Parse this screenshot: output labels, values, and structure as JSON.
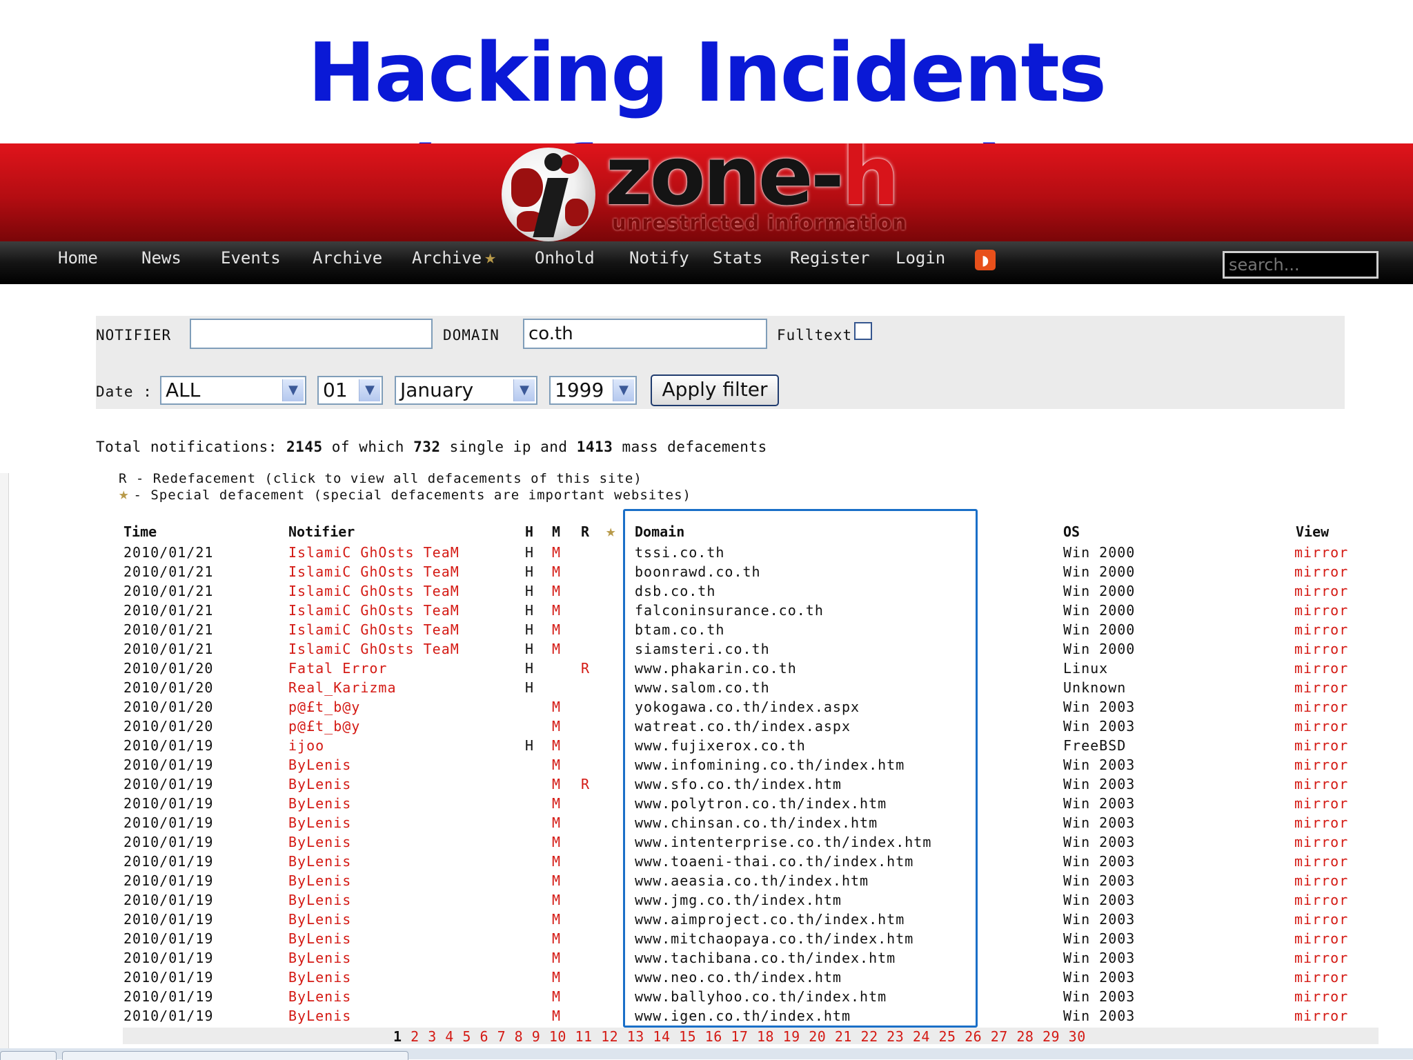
{
  "slide": {
    "title": "Hacking Incidents (Defacement)"
  },
  "logo": {
    "word_main": "zone-",
    "word_accent": "h",
    "tagline": "unrestricted information"
  },
  "nav": {
    "items": [
      "Home",
      "News",
      "Events",
      "Archive",
      "Archive",
      "Onhold",
      "Notify",
      "Stats",
      "Register",
      "Login"
    ],
    "archive_star_icon": "star-icon",
    "rss_icon": "rss-icon",
    "search_placeholder": "search..."
  },
  "filter": {
    "notifier_label": "NOTIFIER",
    "notifier_value": "",
    "domain_label": "DOMAIN",
    "domain_value": "co.th",
    "fulltext_label": "Fulltext",
    "date_label": "Date :",
    "selects": [
      "ALL",
      "01",
      "January",
      "1999"
    ],
    "apply_label": "Apply filter"
  },
  "totals": {
    "prefix": "Total notifications:",
    "total": "2145",
    "mid1": "of which",
    "single": "732",
    "mid2": "single ip and",
    "mass": "1413",
    "suffix": "mass defacements"
  },
  "legend": {
    "r": "R - Redefacement (click to view all defacements of this site)",
    "star": "- Special defacement (special defacements are important websites)"
  },
  "table": {
    "headers": {
      "time": "Time",
      "notifier": "Notifier",
      "h": "H",
      "m": "M",
      "r": "R",
      "domain": "Domain",
      "os": "OS",
      "view": "View"
    },
    "rows": [
      {
        "time": "2010/01/21",
        "notifier": "IslamiC GhOsts TeaM",
        "h": "H",
        "m": "M",
        "r": "",
        "domain": "tssi.co.th",
        "os": "Win 2000",
        "view": "mirror"
      },
      {
        "time": "2010/01/21",
        "notifier": "IslamiC GhOsts TeaM",
        "h": "H",
        "m": "M",
        "r": "",
        "domain": "boonrawd.co.th",
        "os": "Win 2000",
        "view": "mirror"
      },
      {
        "time": "2010/01/21",
        "notifier": "IslamiC GhOsts TeaM",
        "h": "H",
        "m": "M",
        "r": "",
        "domain": "dsb.co.th",
        "os": "Win 2000",
        "view": "mirror"
      },
      {
        "time": "2010/01/21",
        "notifier": "IslamiC GhOsts TeaM",
        "h": "H",
        "m": "M",
        "r": "",
        "domain": "falconinsurance.co.th",
        "os": "Win 2000",
        "view": "mirror"
      },
      {
        "time": "2010/01/21",
        "notifier": "IslamiC GhOsts TeaM",
        "h": "H",
        "m": "M",
        "r": "",
        "domain": "btam.co.th",
        "os": "Win 2000",
        "view": "mirror"
      },
      {
        "time": "2010/01/21",
        "notifier": "IslamiC GhOsts TeaM",
        "h": "H",
        "m": "M",
        "r": "",
        "domain": "siamsteri.co.th",
        "os": "Win 2000",
        "view": "mirror"
      },
      {
        "time": "2010/01/20",
        "notifier": "Fatal Error",
        "h": "H",
        "m": "",
        "r": "R",
        "domain": "www.phakarin.co.th",
        "os": "Linux",
        "view": "mirror"
      },
      {
        "time": "2010/01/20",
        "notifier": "Real_Karizma",
        "h": "H",
        "m": "",
        "r": "",
        "domain": "www.salom.co.th",
        "os": "Unknown",
        "view": "mirror"
      },
      {
        "time": "2010/01/20",
        "notifier": "p@£t_b@y",
        "h": "",
        "m": "M",
        "r": "",
        "domain": "yokogawa.co.th/index.aspx",
        "os": "Win 2003",
        "view": "mirror"
      },
      {
        "time": "2010/01/20",
        "notifier": "p@£t_b@y",
        "h": "",
        "m": "M",
        "r": "",
        "domain": "watreat.co.th/index.aspx",
        "os": "Win 2003",
        "view": "mirror"
      },
      {
        "time": "2010/01/19",
        "notifier": "ijoo",
        "h": "H",
        "m": "M",
        "r": "",
        "domain": "www.fujixerox.co.th",
        "os": "FreeBSD",
        "view": "mirror"
      },
      {
        "time": "2010/01/19",
        "notifier": "ByLenis",
        "h": "",
        "m": "M",
        "r": "",
        "domain": "www.infomining.co.th/index.htm",
        "os": "Win 2003",
        "view": "mirror"
      },
      {
        "time": "2010/01/19",
        "notifier": "ByLenis",
        "h": "",
        "m": "M",
        "r": "R",
        "domain": "www.sfo.co.th/index.htm",
        "os": "Win 2003",
        "view": "mirror"
      },
      {
        "time": "2010/01/19",
        "notifier": "ByLenis",
        "h": "",
        "m": "M",
        "r": "",
        "domain": "www.polytron.co.th/index.htm",
        "os": "Win 2003",
        "view": "mirror"
      },
      {
        "time": "2010/01/19",
        "notifier": "ByLenis",
        "h": "",
        "m": "M",
        "r": "",
        "domain": "www.chinsan.co.th/index.htm",
        "os": "Win 2003",
        "view": "mirror"
      },
      {
        "time": "2010/01/19",
        "notifier": "ByLenis",
        "h": "",
        "m": "M",
        "r": "",
        "domain": "www.intenterprise.co.th/index.htm",
        "os": "Win 2003",
        "view": "mirror"
      },
      {
        "time": "2010/01/19",
        "notifier": "ByLenis",
        "h": "",
        "m": "M",
        "r": "",
        "domain": "www.toaeni-thai.co.th/index.htm",
        "os": "Win 2003",
        "view": "mirror"
      },
      {
        "time": "2010/01/19",
        "notifier": "ByLenis",
        "h": "",
        "m": "M",
        "r": "",
        "domain": "www.aeasia.co.th/index.htm",
        "os": "Win 2003",
        "view": "mirror"
      },
      {
        "time": "2010/01/19",
        "notifier": "ByLenis",
        "h": "",
        "m": "M",
        "r": "",
        "domain": "www.jmg.co.th/index.htm",
        "os": "Win 2003",
        "view": "mirror"
      },
      {
        "time": "2010/01/19",
        "notifier": "ByLenis",
        "h": "",
        "m": "M",
        "r": "",
        "domain": "www.aimproject.co.th/index.htm",
        "os": "Win 2003",
        "view": "mirror"
      },
      {
        "time": "2010/01/19",
        "notifier": "ByLenis",
        "h": "",
        "m": "M",
        "r": "",
        "domain": "www.mitchaopaya.co.th/index.htm",
        "os": "Win 2003",
        "view": "mirror"
      },
      {
        "time": "2010/01/19",
        "notifier": "ByLenis",
        "h": "",
        "m": "M",
        "r": "",
        "domain": "www.tachibana.co.th/index.htm",
        "os": "Win 2003",
        "view": "mirror"
      },
      {
        "time": "2010/01/19",
        "notifier": "ByLenis",
        "h": "",
        "m": "M",
        "r": "",
        "domain": "www.neo.co.th/index.htm",
        "os": "Win 2003",
        "view": "mirror"
      },
      {
        "time": "2010/01/19",
        "notifier": "ByLenis",
        "h": "",
        "m": "M",
        "r": "",
        "domain": "www.ballyhoo.co.th/index.htm",
        "os": "Win 2003",
        "view": "mirror"
      },
      {
        "time": "2010/01/19",
        "notifier": "ByLenis",
        "h": "",
        "m": "M",
        "r": "",
        "domain": "www.igen.co.th/index.htm",
        "os": "Win 2003",
        "view": "mirror"
      }
    ]
  },
  "pager": {
    "current": "1",
    "pages": [
      "2",
      "3",
      "4",
      "5",
      "6",
      "7",
      "8",
      "9",
      "10",
      "11",
      "12",
      "13",
      "14",
      "15",
      "16",
      "17",
      "18",
      "19",
      "20",
      "21",
      "22",
      "23",
      "24",
      "25",
      "26",
      "27",
      "28",
      "29",
      "30"
    ]
  },
  "colors": {
    "title_blue": "#0a19d6",
    "banner_red": "#c8111a",
    "link_red": "#d41a14",
    "highlight_box": "#1a6fc8"
  }
}
